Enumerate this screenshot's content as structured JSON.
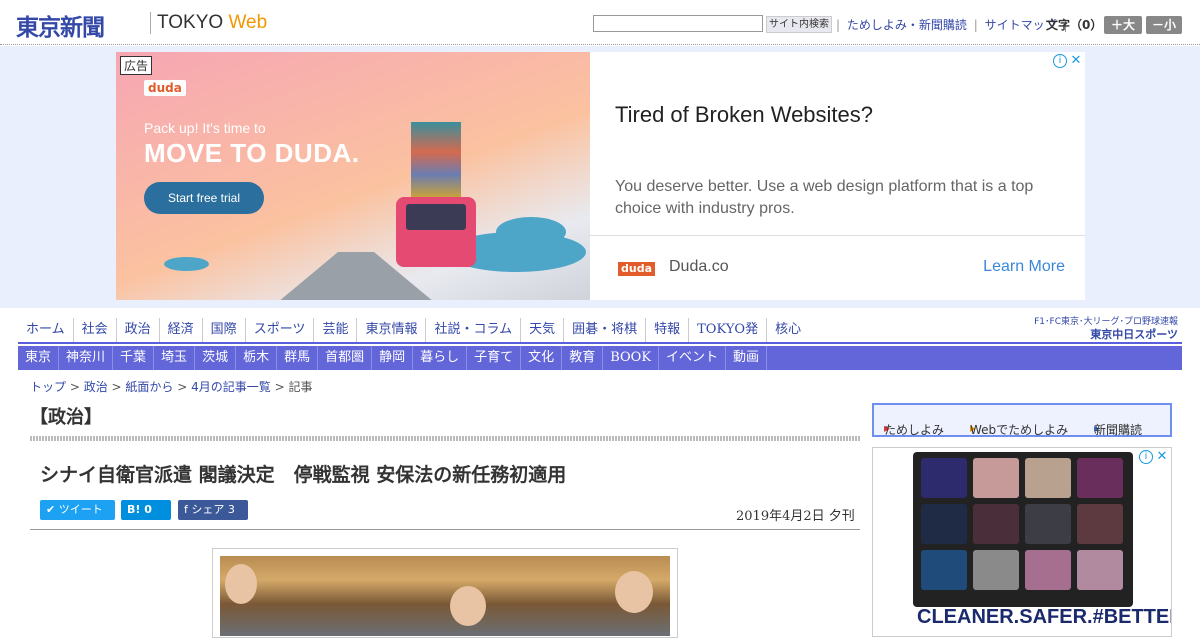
{
  "header": {
    "logo_jp": "東京新聞",
    "logo_tokyo": "TOKYO",
    "logo_web": "Web",
    "search_placeholder": "",
    "search_button": "サイト内検索",
    "links": [
      "ためしよみ・新聞購読",
      "サイトマップ"
    ],
    "font_size_label": "文字（0）",
    "font_big": "＋大",
    "font_small": "－小"
  },
  "top_ad": {
    "label": "広告",
    "brand_logo": "duda",
    "tagline": "Pack up! It's time to",
    "headline_img": "MOVE TO DUDA.",
    "cta_img": "Start free trial",
    "title": "Tired of Broken Websites?",
    "description": "You deserve better. Use a web design platform that is a top choice with industry pros.",
    "brand_badge": "duda",
    "domain": "Duda.co",
    "cta": "Learn More",
    "choices_info": "i",
    "choices_close": "✕"
  },
  "nav_primary": [
    "ホーム",
    "社会",
    "政治",
    "経済",
    "国際",
    "スポーツ",
    "芸能",
    "東京情報",
    "社説・コラム",
    "天気",
    "囲碁・将棋",
    "特報",
    "TOKYO発",
    "核心"
  ],
  "chunichi": {
    "line1": "F1･FC東京･大リーグ･プロ野球速報",
    "line2": "東京中日スポーツ"
  },
  "nav_secondary": [
    "東京",
    "神奈川",
    "千葉",
    "埼玉",
    "茨城",
    "栃木",
    "群馬",
    "首都圏",
    "静岡",
    "暮らし",
    "子育て",
    "文化",
    "教育",
    "BOOK",
    "イベント",
    "動画"
  ],
  "breadcrumb": {
    "items": [
      "トップ",
      "政治",
      "紙面から",
      "4月の記事一覧"
    ],
    "current": "記事",
    "sep": " > "
  },
  "article": {
    "section": "【政治】",
    "headline": "シナイ自衛官派遣 閣議決定　停戦監視 安保法の新任務初適用",
    "share_twitter": "ツイート",
    "share_hatena": "B! 0",
    "share_facebook": "シェア 3",
    "date": "2019年4月2日 夕刊"
  },
  "sidebar": {
    "buttons": [
      "ためしよみ",
      "Webでためしよみ",
      "新聞購読"
    ],
    "ad_text": "CLEANER.SAFER.#BETTERBEAUTY",
    "choices_info": "i",
    "choices_close": "✕"
  },
  "colors": {
    "brand_blue": "#3448a8",
    "nav_bar": "#6266d8",
    "web_orange": "#f39800",
    "ad_band": "#e9effc"
  }
}
